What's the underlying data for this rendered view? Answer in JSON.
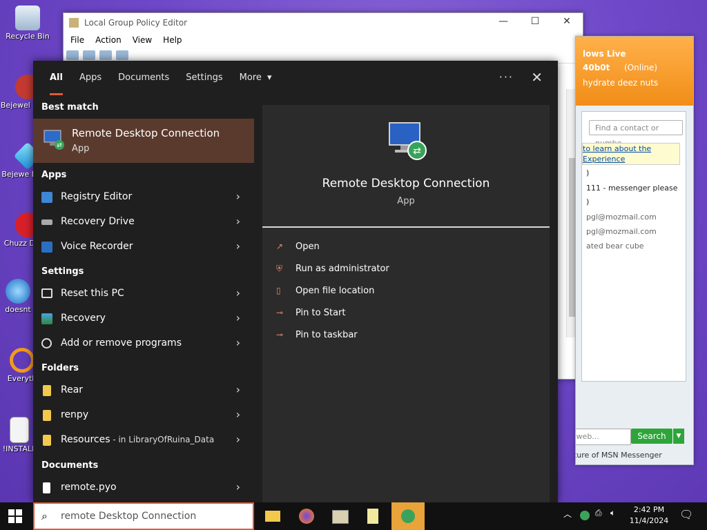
{
  "desktop": {
    "icons": [
      {
        "label": "Recycle Bin"
      },
      {
        "label": "Bejewel Delux"
      },
      {
        "label": "Bejewe Delux"
      },
      {
        "label": "Chuzz Delux"
      },
      {
        "label": "doesnt"
      },
      {
        "label": "Everyth"
      },
      {
        "label": "!INSTALL"
      }
    ]
  },
  "gp_editor": {
    "title": "Local Group Policy Editor",
    "menu": [
      "File",
      "Action",
      "View",
      "Help"
    ]
  },
  "messenger": {
    "header": [
      "lows Live",
      "40b0t",
      "(Online)",
      "hydrate deez nuts"
    ],
    "find_placeholder": "Find a contact or numbe",
    "info_lines": [
      "to learn about the",
      "Experience"
    ],
    "rows": [
      ")",
      "111 - messenger please",
      ")",
      "pgl@mozmail.com",
      "pgl@mozmail.com",
      "ated bear cube"
    ],
    "web_placeholder": "the web...",
    "search_label": "Search",
    "footer": "e Future of MSN Messenger"
  },
  "search_panel": {
    "tabs": [
      "All",
      "Apps",
      "Documents",
      "Settings",
      "More"
    ],
    "more_caret": "▾",
    "dots": "···",
    "close": "✕",
    "best_match_heading": "Best match",
    "best_match": {
      "name": "Remote Desktop Connection",
      "kind": "App"
    },
    "sections": {
      "apps": "Apps",
      "settings": "Settings",
      "folders": "Folders",
      "documents": "Documents"
    },
    "apps": [
      {
        "label": "Registry Editor",
        "icon": "registry-icon"
      },
      {
        "label": "Recovery Drive",
        "icon": "drive-icon"
      },
      {
        "label": "Voice Recorder",
        "icon": "microphone-icon"
      }
    ],
    "settings": [
      {
        "label": "Reset this PC",
        "icon": "reset-pc-icon"
      },
      {
        "label": "Recovery",
        "icon": "recovery-icon"
      },
      {
        "label": "Add or remove programs",
        "icon": "gear-icon"
      }
    ],
    "folders": [
      {
        "label": "Rear",
        "suffix": ""
      },
      {
        "label": "renpy",
        "suffix": ""
      },
      {
        "label": "Resources",
        "suffix": " - in LibraryOfRuina_Data"
      }
    ],
    "documents": [
      {
        "label": "remote.pyo"
      }
    ],
    "chevron": "›",
    "detail": {
      "name": "Remote Desktop Connection",
      "kind": "App",
      "actions": [
        {
          "label": "Open",
          "glyph": "↗"
        },
        {
          "label": "Run as administrator",
          "glyph": "⛨"
        },
        {
          "label": "Open file location",
          "glyph": "▯"
        },
        {
          "label": "Pin to Start",
          "glyph": "⊸"
        },
        {
          "label": "Pin to taskbar",
          "glyph": "⊸"
        }
      ]
    }
  },
  "taskbar": {
    "search_query": "remote Desktop Connection",
    "time": "2:42 PM",
    "date": "11/4/2024"
  },
  "colors": {
    "accent": "#e05a38",
    "best_match_bg": "#5b3a2e",
    "panel_bg": "#1f1f1f",
    "detail_bg": "#2b2b2b"
  }
}
